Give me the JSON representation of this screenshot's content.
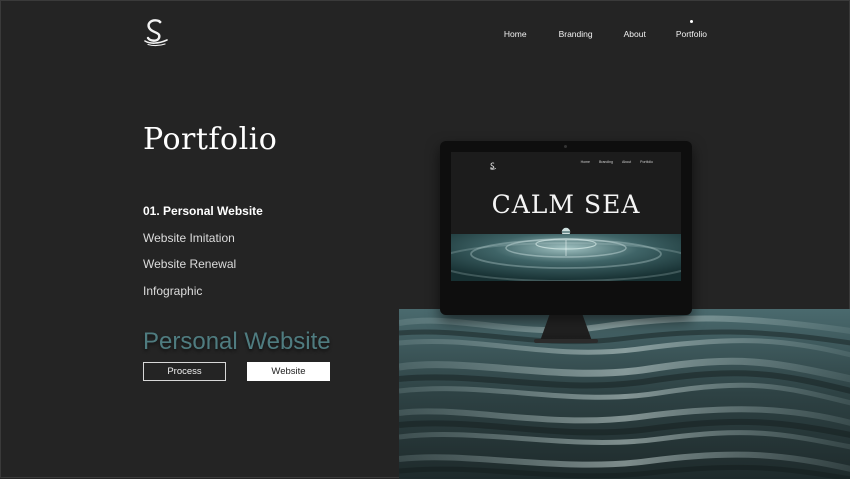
{
  "header": {
    "logo_icon": "swan-s-logo-icon",
    "nav": [
      {
        "label": "Home"
      },
      {
        "label": "Branding"
      },
      {
        "label": "About"
      },
      {
        "label": "Portfolio",
        "active": true
      }
    ]
  },
  "main": {
    "title": "Portfolio",
    "projects": [
      {
        "label": "01. Personal Website",
        "active": true
      },
      {
        "label": "Website Imitation"
      },
      {
        "label": "Website Renewal"
      },
      {
        "label": "Infographic"
      }
    ],
    "project_name": "Personal Website",
    "buttons": {
      "process": "Process",
      "website": "Website"
    }
  },
  "preview": {
    "headline": "CALM SEA",
    "nav": [
      "Home",
      "Branding",
      "About",
      "Portfolio"
    ]
  },
  "colors": {
    "background": "#242424",
    "accent": "#4f7c80",
    "water": "#3e5a5e"
  }
}
